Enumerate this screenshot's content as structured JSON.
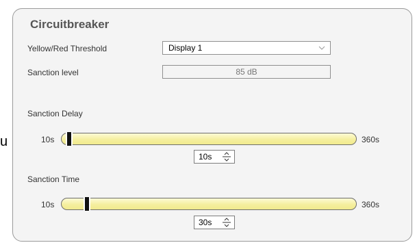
{
  "stray_text": "u",
  "panel": {
    "title": "Circuitbreaker",
    "threshold": {
      "label": "Yellow/Red Threshold",
      "value": "Display 1"
    },
    "sanction_level": {
      "label": "Sanction level",
      "value": "85 dB"
    },
    "sanction_delay": {
      "label": "Sanction Delay",
      "min": "10s",
      "max": "360s",
      "value": "10s",
      "value_seconds": 10
    },
    "sanction_time": {
      "label": "Sanction Time",
      "min": "10s",
      "max": "360s",
      "value": "30s",
      "value_seconds": 30
    }
  },
  "colors": {
    "track_fill": "#f5ef9f",
    "panel_bg": "#f4f4f4",
    "thumb": "#111111"
  },
  "icons": {
    "dropdown": "chevron-down-icon",
    "spinner": "spinner-arrows-icon"
  }
}
